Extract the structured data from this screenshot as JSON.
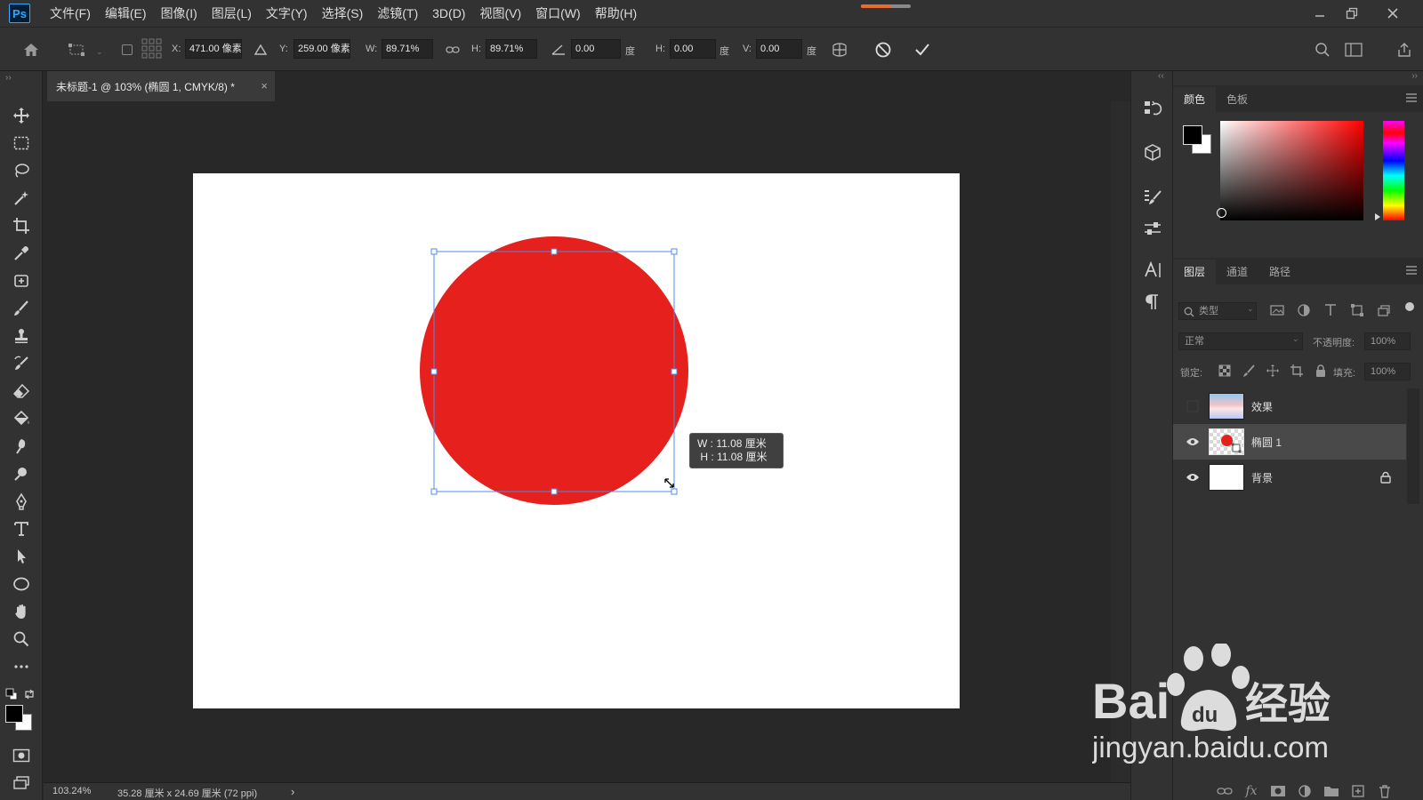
{
  "app": {
    "logo": "Ps"
  },
  "menu": [
    "文件(F)",
    "编辑(E)",
    "图像(I)",
    "图层(L)",
    "文字(Y)",
    "选择(S)",
    "滤镜(T)",
    "3D(D)",
    "视图(V)",
    "窗口(W)",
    "帮助(H)"
  ],
  "options": {
    "x_label": "X:",
    "x_value": "471.00 像素",
    "y_label": "Y:",
    "y_value": "259.00 像素",
    "w_label": "W:",
    "w_value": "89.71%",
    "h_label": "H:",
    "h_value": "89.71%",
    "angle_value": "0.00",
    "angle_unit": "度",
    "skew_h_label": "H:",
    "skew_h_value": "0.00",
    "skew_h_unit": "度",
    "skew_v_label": "V:",
    "skew_v_value": "0.00",
    "skew_v_unit": "度"
  },
  "document": {
    "tab_title": "未标题-1 @ 103% (椭圆 1, CMYK/8) *",
    "tab_close": "×",
    "tooltip": "W : 11.08 厘米\n H : 11.08 厘米",
    "circle_color": "#e5201d"
  },
  "status": {
    "zoom": "103.24%",
    "doc_info": "35.28 厘米 x 24.69 厘米 (72 ppi)",
    "arrow": "›"
  },
  "color_panel": {
    "tabs": [
      "颜色",
      "色板"
    ]
  },
  "layers_panel": {
    "tabs": [
      "图层",
      "通道",
      "路径"
    ],
    "filter_placeholder": "类型",
    "blend_mode": "正常",
    "opacity_label": "不透明度:",
    "opacity_value": "100%",
    "lock_label": "锁定:",
    "fill_label": "填充:",
    "fill_value": "100%",
    "layers": [
      {
        "name": "效果",
        "visible": false,
        "selected": false
      },
      {
        "name": "椭圆 1",
        "visible": true,
        "selected": true
      },
      {
        "name": "背景",
        "visible": true,
        "selected": false,
        "locked": true
      }
    ]
  },
  "watermark": {
    "brand": "Bai",
    "brand_du": "du",
    "cn": "经验",
    "url": "jingyan.baidu.com"
  },
  "colors": {
    "accent": "#31a8ff",
    "selection": "#4f8de8",
    "fg": "#000000",
    "bg": "#ffffff"
  }
}
